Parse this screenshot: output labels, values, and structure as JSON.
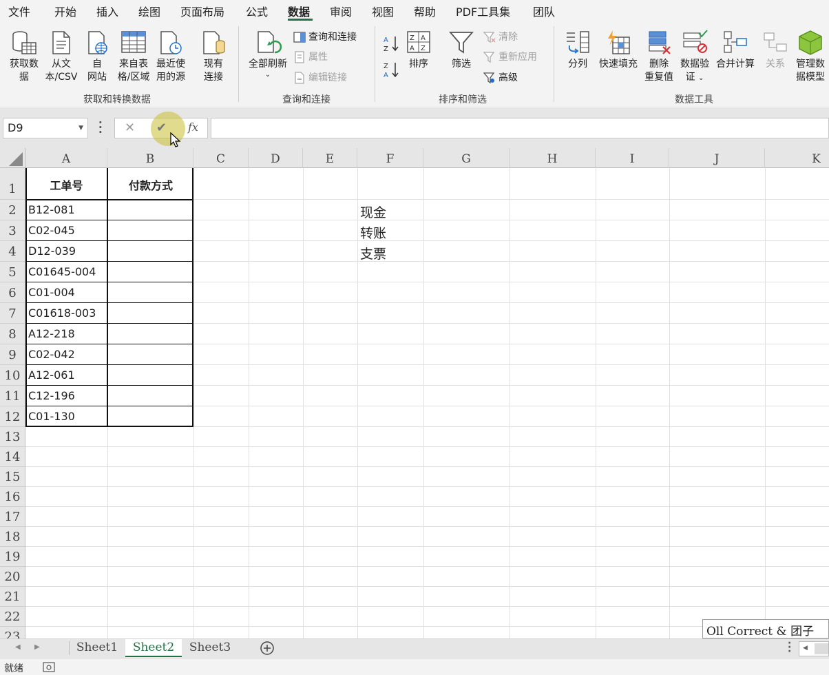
{
  "menu": {
    "items": [
      "文件",
      "开始",
      "插入",
      "绘图",
      "页面布局",
      "公式",
      "数据",
      "审阅",
      "视图",
      "帮助",
      "PDF工具集",
      "团队"
    ],
    "active": "数据"
  },
  "ribbon": {
    "get_transform": {
      "get_data": [
        "获取数",
        "据"
      ],
      "from_text": [
        "从文",
        "本/CSV"
      ],
      "from_web": [
        "自",
        "网站"
      ],
      "from_table": [
        "来自表",
        "格/区域"
      ],
      "recent_sources": [
        "最近使",
        "用的源"
      ],
      "existing": [
        "现有",
        "连接"
      ],
      "group_label": "获取和转换数据"
    },
    "queries": {
      "refresh_all": "全部刷新",
      "queries_connections": "查询和连接",
      "properties": "属性",
      "edit_links": "编辑链接",
      "group_label": "查询和连接"
    },
    "sort_filter": {
      "sort": "排序",
      "filter": "筛选",
      "clear": "清除",
      "reapply": "重新应用",
      "advanced": "高级",
      "group_label": "排序和筛选"
    },
    "data_tools": {
      "text_to_columns": "分列",
      "flash_fill": "快速填充",
      "remove_dup": [
        "删除",
        "重复值"
      ],
      "validation": [
        "数据验",
        "证"
      ],
      "consolidate": "合并计算",
      "relationships": "关系",
      "manage_model": [
        "管理数",
        "据模型"
      ],
      "group_label": "数据工具"
    }
  },
  "formula_bar": {
    "name_box": "D9",
    "cancel_glyph": "✕",
    "enter_glyph": "✔",
    "fx": "fx",
    "value": ""
  },
  "columns": [
    "A",
    "B",
    "C",
    "D",
    "E",
    "F",
    "G",
    "H",
    "I",
    "J",
    "K"
  ],
  "rows": [
    "1",
    "2",
    "3",
    "4",
    "5",
    "6",
    "7",
    "8",
    "9",
    "10",
    "11",
    "12",
    "13",
    "14",
    "15",
    "16",
    "17",
    "18",
    "19",
    "20",
    "21",
    "22",
    "23"
  ],
  "table": {
    "headers": [
      "工单号",
      "付款方式"
    ],
    "order_ids": [
      "B12-081",
      "C02-045",
      "D12-039",
      "C01645-004",
      "C01-004",
      "C01618-003",
      "A12-218",
      "C02-042",
      "A12-061",
      "C12-196",
      "C01-130"
    ]
  },
  "payment_options": [
    "现金",
    "转账",
    "支票"
  ],
  "sheets": [
    "Sheet1",
    "Sheet2",
    "Sheet3"
  ],
  "active_sheet": "Sheet2",
  "status": {
    "ready": "就绪"
  },
  "watermark": "Oll Correct & 团子"
}
